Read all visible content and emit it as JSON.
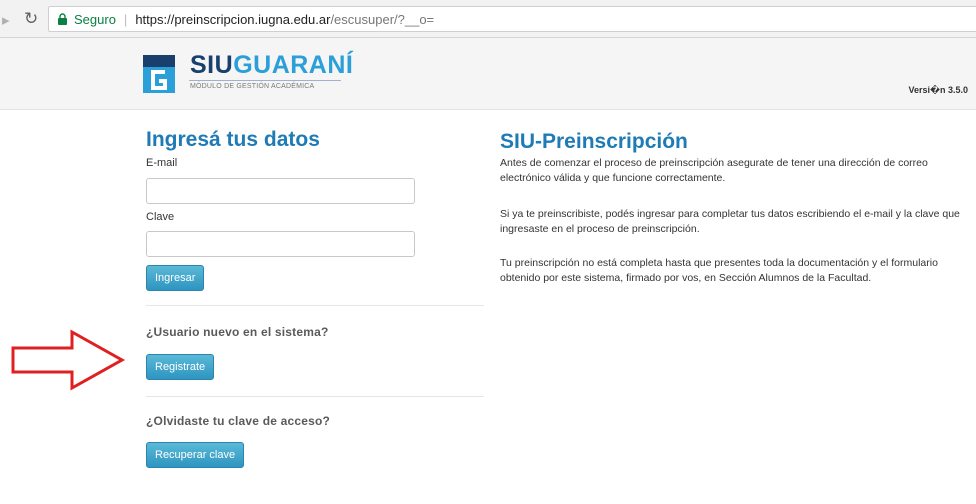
{
  "browser": {
    "secure_label": "Seguro",
    "url_host": "https://preinscripcion.iugna.edu.ar",
    "url_path": "/escusuper/?__o="
  },
  "header": {
    "logo_siu": "SIU",
    "logo_guarani": "GUARANÍ",
    "logo_subtitle": "MÓDULO DE GESTIÓN ACADÉMICA",
    "version": "Versi�n 3.5.0"
  },
  "login": {
    "title": "Ingresá tus datos",
    "email_label": "E-mail",
    "email_value": "",
    "password_label": "Clave",
    "password_value": "",
    "submit_label": "Ingresar"
  },
  "register": {
    "question": "¿Usuario nuevo en el sistema?",
    "button_label": "Registrate"
  },
  "recover": {
    "question": "¿Olvidaste tu clave de acceso?",
    "button_label": "Recuperar clave"
  },
  "info": {
    "title": "SIU-Preinscripción",
    "paragraphs": [
      "Antes de comenzar el proceso de preinscripción asegurate de tener una dirección de correo electrónico válida y que funcione correctamente.",
      "Si ya te preinscribiste, podés ingresar para completar tus datos escribiendo el e-mail y la clave que ingresaste en el proceso de preinscripción.",
      "Tu preinscripción no está completa hasta que presentes toda la documentación y el formulario obtenido por este sistema, firmado por vos, en Sección Alumnos de la Facultad."
    ]
  },
  "colors": {
    "accent": "#1f7bb6",
    "button": "#2e95c1",
    "annotation_arrow": "#e02020",
    "secure": "#0b8043"
  },
  "icons": [
    "forward-icon",
    "reload-icon",
    "lock-icon",
    "siu-g-logo-icon",
    "red-arrow-annotation"
  ]
}
